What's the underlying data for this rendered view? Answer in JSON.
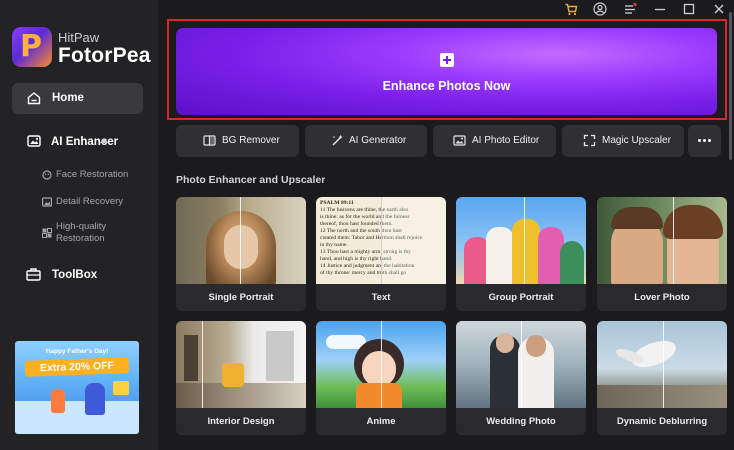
{
  "app": {
    "brand_line1": "HitPaw",
    "brand_line2": "FotorPea",
    "logo_letter": "P"
  },
  "sidebar": {
    "home": {
      "label": "Home",
      "icon": "home-icon"
    },
    "ai_enhancer": {
      "label": "AI Enhancer",
      "icon": "enhancer-icon",
      "items": [
        {
          "label": "Face Restoration",
          "icon": "face-icon"
        },
        {
          "label": "Detail Recovery",
          "icon": "image-icon"
        },
        {
          "label_line1": "High-quality",
          "label_line2": "Restoration",
          "icon": "grid-icon"
        }
      ]
    },
    "toolbox": {
      "label": "ToolBox",
      "icon": "toolbox-icon"
    },
    "promo": {
      "line1": "Happy Father's Day!",
      "line2": "Extra 20% OFF"
    }
  },
  "titlebar": {
    "icons": [
      "cart-icon",
      "account-icon",
      "menu-icon",
      "minimize-icon",
      "maximize-icon",
      "close-icon"
    ]
  },
  "hero": {
    "label": "Enhance Photos Now"
  },
  "tools": [
    {
      "label": "BG Remover",
      "icon": "bg-remover-icon"
    },
    {
      "label": "AI Generator",
      "icon": "magic-wand-icon"
    },
    {
      "label": "AI Photo Editor",
      "icon": "photo-editor-icon"
    },
    {
      "label": "Magic Upscaler",
      "icon": "upscale-icon"
    }
  ],
  "section": {
    "title": "Photo Enhancer and Upscaler"
  },
  "cards": [
    {
      "label": "Single Portrait"
    },
    {
      "label": "Text",
      "text_lines": [
        "PSALM 89:11",
        "11 The heavens are thine, the earth also",
        "is thine: as for the world and the fulness",
        "thereof, thou hast founded them.",
        "12 The north and the south thou hast",
        "created them: Tabor and Hermon shall rejoice",
        "in thy name.",
        "13 Thou hast a mighty arm: strong is thy",
        "hand, and high is thy right hand.",
        "14 Justice and judgment are the habitation",
        "of thy throne: mercy and truth shall go"
      ]
    },
    {
      "label": "Group Portrait"
    },
    {
      "label": "Lover Photo"
    },
    {
      "label": "Interior Design"
    },
    {
      "label": "Anime"
    },
    {
      "label": "Wedding Photo"
    },
    {
      "label": "Dynamic Deblurring"
    }
  ],
  "colors": {
    "accent_purple": "#7a1fe8",
    "highlight_red": "#d8262a",
    "background": "#1b1b1d",
    "sidebar": "#232326"
  }
}
